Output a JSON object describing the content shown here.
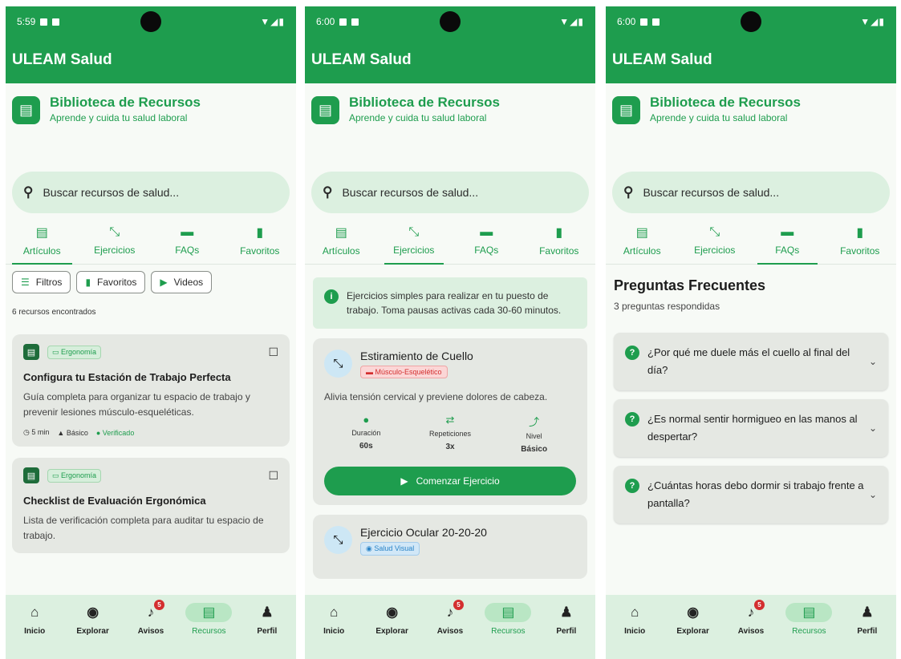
{
  "app_title": "ULEAM Salud",
  "header": {
    "title": "Biblioteca de Recursos",
    "subtitle": "Aprende y cuida tu salud laboral"
  },
  "search": {
    "placeholder": "Buscar recursos de salud..."
  },
  "tabs": [
    {
      "label": "Artículos",
      "icon": "article-icon"
    },
    {
      "label": "Ejercicios",
      "icon": "stretch-icon"
    },
    {
      "label": "FAQs",
      "icon": "chat-icon"
    },
    {
      "label": "Favoritos",
      "icon": "bookmark-icon"
    }
  ],
  "bottom_nav": [
    {
      "label": "Inicio",
      "icon": "home-icon"
    },
    {
      "label": "Explorar",
      "icon": "compass-icon"
    },
    {
      "label": "Avisos",
      "icon": "bell-icon",
      "badge": "5"
    },
    {
      "label": "Recursos",
      "icon": "library-icon"
    },
    {
      "label": "Perfil",
      "icon": "person-icon"
    }
  ],
  "screens": [
    {
      "status_time": "5:59",
      "active_tab": "Artículos",
      "filters": [
        {
          "label": "Filtros",
          "icon": "filter-icon"
        },
        {
          "label": "Favoritos",
          "icon": "bookmark-icon"
        },
        {
          "label": "Videos",
          "icon": "play-icon"
        }
      ],
      "count_text": "6 recursos encontrados",
      "articles": [
        {
          "tag": "Ergonomía",
          "title": "Configura tu Estación de Trabajo Perfecta",
          "description": "Guía completa para organizar tu espacio de trabajo y prevenir lesiones músculo-esqueléticas.",
          "time": "5 min",
          "level": "Básico",
          "verified": "Verificado"
        },
        {
          "tag": "Ergonomía",
          "title": "Checklist de Evaluación Ergonómica",
          "description": "Lista de verificación completa para auditar tu espacio de trabajo."
        }
      ]
    },
    {
      "status_time": "6:00",
      "active_tab": "Ejercicios",
      "info_text": "Ejercicios simples para realizar en tu puesto de trabajo. Toma pausas activas cada 30-60 minutos.",
      "exercises": [
        {
          "title": "Estiramiento de Cuello",
          "tag": "Músculo-Esquelético",
          "description": "Alivia tensión cervical y previene dolores de cabeza.",
          "stats": [
            {
              "label": "Duración",
              "value": "60s",
              "icon": "timer-icon"
            },
            {
              "label": "Repeticiones",
              "value": "3x",
              "icon": "repeat-icon"
            },
            {
              "label": "Nivel",
              "value": "Básico",
              "icon": "trending-icon"
            }
          ],
          "button": "Comenzar Ejercicio"
        },
        {
          "title": "Ejercicio Ocular 20-20-20",
          "tag": "Salud Visual"
        }
      ]
    },
    {
      "status_time": "6:00",
      "active_tab": "FAQs",
      "faq_title": "Preguntas Frecuentes",
      "faq_subtitle": "3 preguntas respondidas",
      "faqs": [
        "¿Por qué me duele más el cuello al final del día?",
        "¿Es normal sentir hormigueo en las manos al despertar?",
        "¿Cuántas horas debo dormir si trabajo frente a pantalla?"
      ]
    }
  ],
  "colors": {
    "primary": "#1e9d4e",
    "nav_bg": "#dcf0e0",
    "card_bg": "#e5e8e3",
    "badge": "#d32f2f"
  }
}
